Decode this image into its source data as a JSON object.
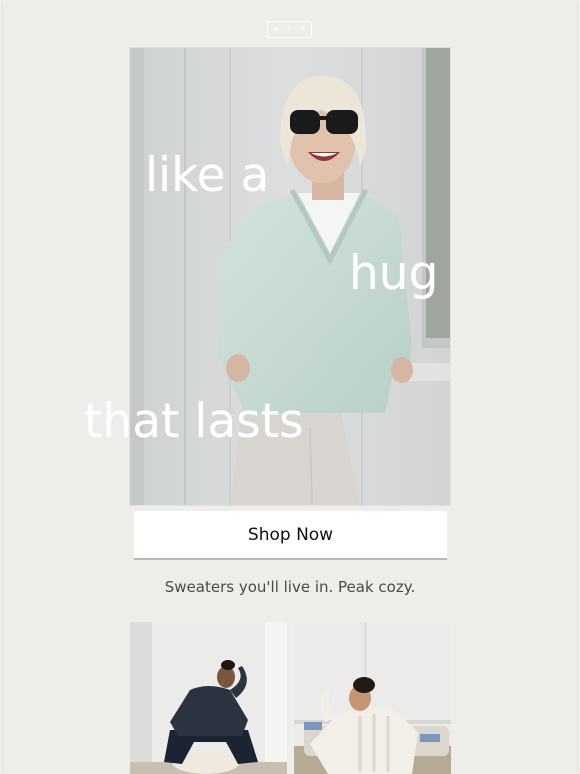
{
  "brand": {
    "logo_text": "A T R"
  },
  "hero": {
    "headline_line_1": "like a",
    "headline_line_2": "hug",
    "headline_line_3": "that lasts"
  },
  "cta": {
    "label": "Shop Now"
  },
  "tagline": "Sweaters you'll live in. Peak cozy.",
  "colors": {
    "background": "#efedea",
    "button_background": "#ffffff",
    "button_text": "#111111",
    "tagline_text": "#4a4a4a",
    "sweater_mint": "#c9dcd6"
  }
}
